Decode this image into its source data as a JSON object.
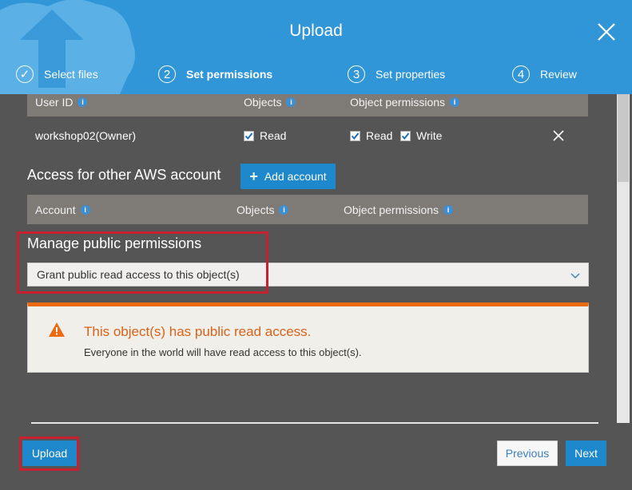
{
  "header": {
    "title": "Upload",
    "steps": [
      {
        "number": "✓",
        "label": "Select files"
      },
      {
        "number": "2",
        "label": "Set permissions"
      },
      {
        "number": "3",
        "label": "Set properties"
      },
      {
        "number": "4",
        "label": "Review"
      }
    ]
  },
  "owner_table": {
    "headers": {
      "user_id": "User ID",
      "objects": "Objects",
      "object_permissions": "Object permissions"
    },
    "row": {
      "user": "workshop02(Owner)",
      "objects_read": "Read",
      "perm_read": "Read",
      "perm_write": "Write"
    }
  },
  "other_accounts": {
    "title": "Access for other AWS account",
    "add_button": "Add account",
    "headers": {
      "account": "Account",
      "objects": "Objects",
      "object_permissions": "Object permissions"
    }
  },
  "public_permissions": {
    "title": "Manage public permissions",
    "selected": "Grant public read access to this object(s)"
  },
  "alert": {
    "title": "This object(s) has public read access.",
    "text": "Everyone in the world will have read access to this object(s)."
  },
  "footer": {
    "upload": "Upload",
    "previous": "Previous",
    "next": "Next"
  },
  "colors": {
    "header": "#3196d8",
    "accent": "#1d88cc",
    "warning": "#eb6b12",
    "highlight": "#c8202e"
  }
}
